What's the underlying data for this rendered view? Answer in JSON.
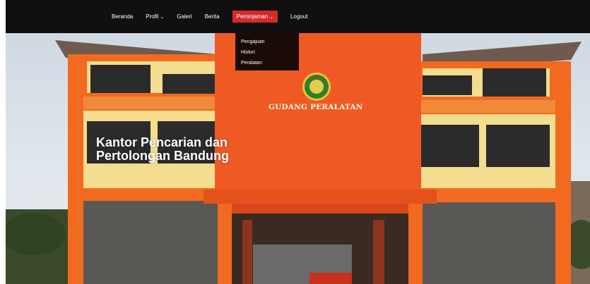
{
  "navbar": {
    "items": [
      {
        "label": "Beranda",
        "has_dropdown": false,
        "active": false
      },
      {
        "label": "Profil",
        "has_dropdown": true,
        "active": false
      },
      {
        "label": "Galeri",
        "has_dropdown": false,
        "active": false
      },
      {
        "label": "Berita",
        "has_dropdown": false,
        "active": false
      },
      {
        "label": "Peminjaman",
        "has_dropdown": true,
        "active": true
      },
      {
        "label": "Logout",
        "has_dropdown": false,
        "active": false
      }
    ],
    "chevron": "⌄",
    "active_color": "#d42a2a",
    "background": "#101010"
  },
  "dropdown": {
    "items": [
      "Pengajuan",
      "Histori",
      "Peralatan"
    ],
    "background": "#1b0b07"
  },
  "hero": {
    "title_line1": "Kantor Pencarian dan",
    "title_line2": "Pertolongan Bandung",
    "building_sign": "GUDANG PERALATAN",
    "emblem_dots": "★★★"
  },
  "icons": {
    "dropdown_chevron": "chevron-down-icon",
    "emblem": "basarnas-emblem-icon"
  },
  "colors": {
    "building_orange": "#f26a1f",
    "tower_orange": "#ef5a24",
    "wall_cream": "#f4dd8e",
    "stone": "#5a5855"
  }
}
